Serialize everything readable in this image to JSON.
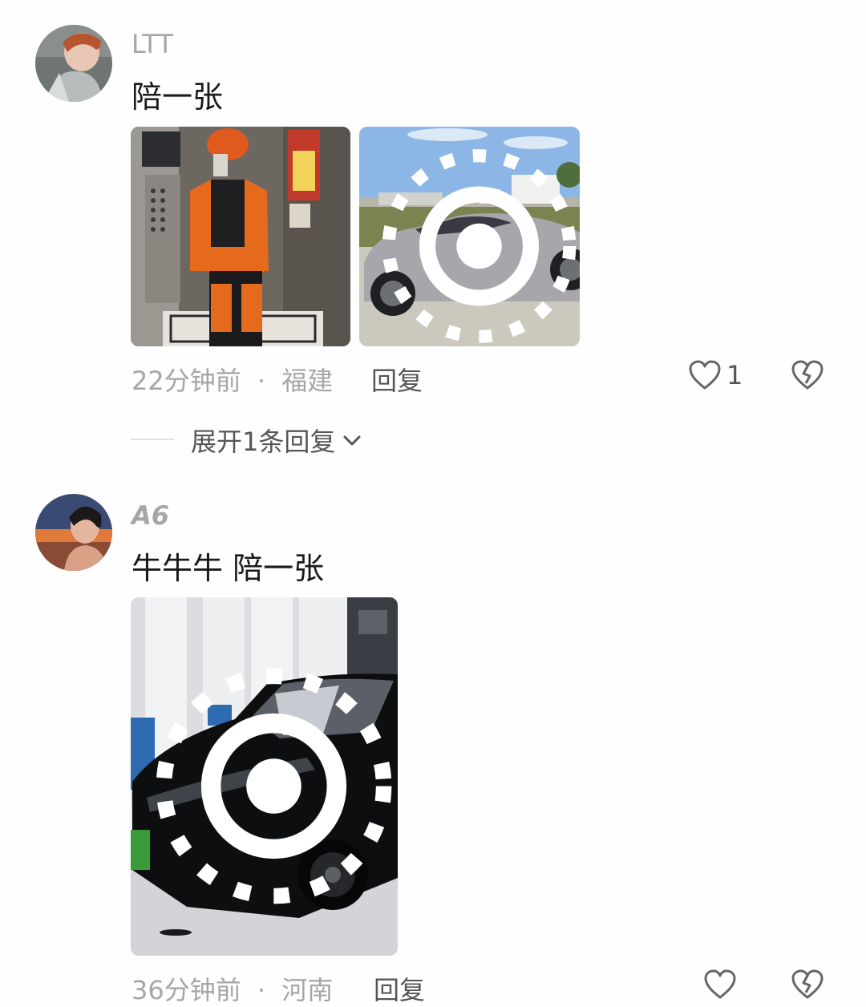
{
  "comments": [
    {
      "username": "LTT",
      "text": "陪一张",
      "time": "22分钟前",
      "separator": "·",
      "location": "福建",
      "reply_label": "回复",
      "like_count": "1",
      "expand_label": "展开1条回复",
      "photos": [
        "elevator-selfie",
        "silver-car"
      ]
    },
    {
      "username": "A6",
      "text": "牛牛牛 陪一张",
      "time": "36分钟前",
      "separator": "·",
      "location": "河南",
      "reply_label": "回复",
      "like_count": "",
      "photos": [
        "black-car"
      ]
    }
  ],
  "icons": {
    "like": "heart-outline-icon",
    "dislike": "broken-heart-icon",
    "expand": "chevron-down-icon",
    "live_photo": "live-photo-icon"
  },
  "colors": {
    "background": "#fefefe",
    "meta_text": "#a6a6a6",
    "primary_text": "#1a1a1a",
    "action_text": "#555555"
  }
}
